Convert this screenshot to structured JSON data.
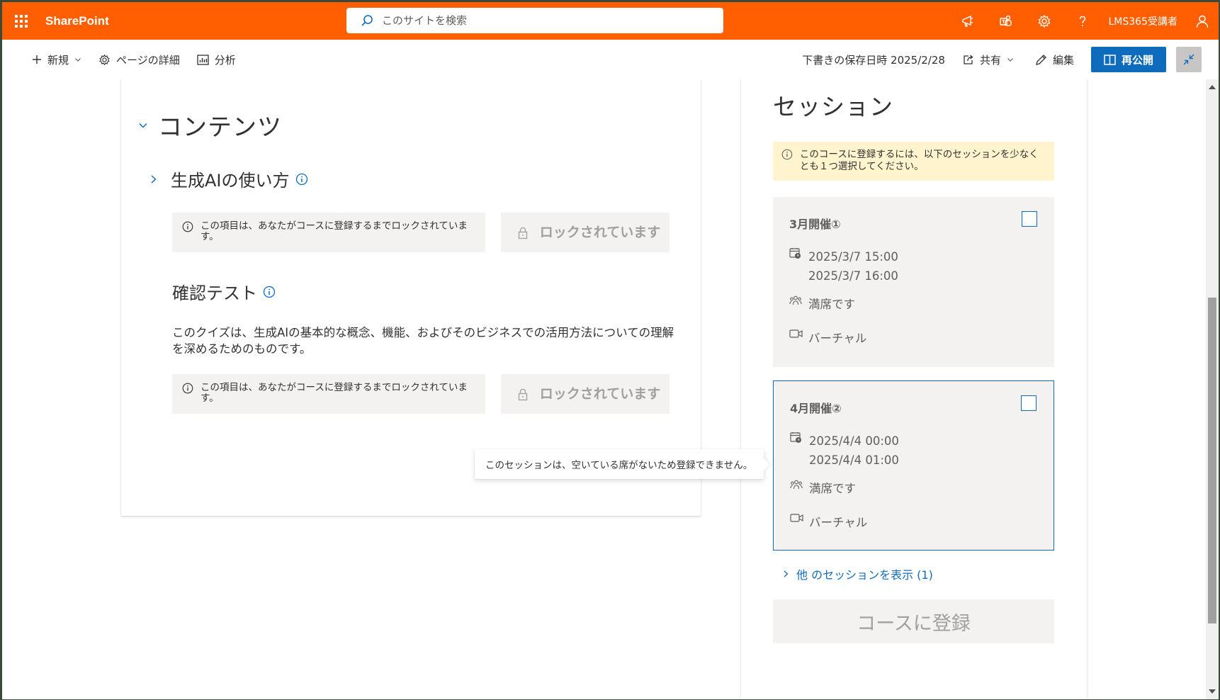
{
  "suite": {
    "brand": "SharePoint",
    "search_placeholder": "このサイトを検索",
    "user_name": "LMS365受講者"
  },
  "commandbar": {
    "new_label": "新規",
    "page_details_label": "ページの詳細",
    "analytics_label": "分析",
    "draft_saved": "下書きの保存日時 2025/2/28",
    "share_label": "共有",
    "edit_label": "編集",
    "republish_label": "再公開"
  },
  "content": {
    "section_title": "コンテンツ",
    "module": {
      "title": "生成AIの使い方",
      "lock_message": "この項目は、あなたがコースに登録するまでロックされています。",
      "lock_button": "ロックされています"
    },
    "quiz": {
      "title": "確認テスト",
      "description": "このクイズは、生成AIの基本的な概念、機能、およびそのビジネスでの活用方法についての理解を深めるためのものです。",
      "lock_message": "この項目は、あなたがコースに登録するまでロックされています。",
      "lock_button": "ロックされています"
    }
  },
  "sessions": {
    "title": "セッション",
    "warning": "このコースに登録するには、以下のセッションを少なくとも１つ選択してください。",
    "items": [
      {
        "name": "3月開催①",
        "start": "2025/3/7 15:00",
        "end": "2025/3/7 16:00",
        "capacity": "満席です",
        "location": "バーチャル",
        "checked": false
      },
      {
        "name": "4月開催②",
        "start": "2025/4/4 00:00",
        "end": "2025/4/4 01:00",
        "capacity": "満席です",
        "location": "バーチャル",
        "checked": false
      }
    ],
    "more_link": "他 のセッションを表示 (1)",
    "enroll_button": "コースに登録",
    "tooltip": "このセッションは、空いている席がないため登録できません。"
  },
  "colors": {
    "suite_bar": "#ff5f00",
    "accent": "#0f6cbd",
    "warning_bg": "#fff4ce",
    "neutral_bg": "#f3f2f1"
  },
  "icons": [
    "waffle-icon",
    "search-icon",
    "megaphone-icon",
    "teams-icon",
    "gear-icon",
    "help-icon",
    "person-icon",
    "plus-icon",
    "chevron-down-icon",
    "gear-icon",
    "analytics-icon",
    "share-icon",
    "pencil-icon",
    "book-icon",
    "collapse-icon",
    "chevron-right-icon",
    "info-icon",
    "lock-icon",
    "calendar-clock-icon",
    "people-icon",
    "video-icon"
  ]
}
